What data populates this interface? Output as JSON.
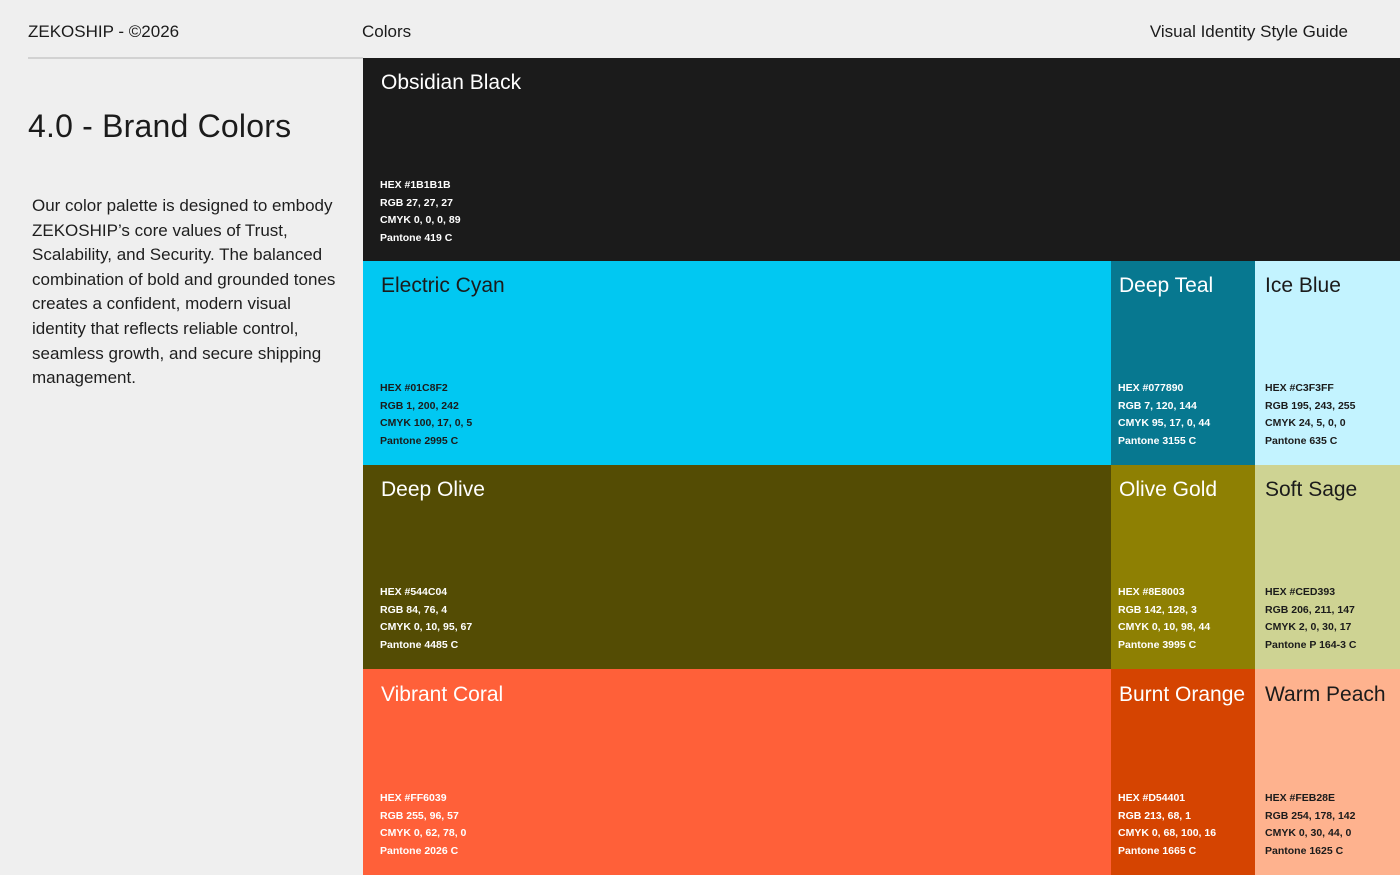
{
  "header": {
    "brand": "ZEKOSHIP - ©2026",
    "section": "Colors",
    "guide": "Visual Identity Style Guide"
  },
  "title": "4.0 - Brand Colors",
  "intro": "Our color palette is designed to embody ZEKOSHIP’s core values of Trust, Scalability, and Security. The balanced combination of bold and grounded tones creates a confident, modern visual identity that reflects reliable control, seamless growth, and secure shipping management.",
  "colors": {
    "obsidian": {
      "name": "Obsidian Black",
      "bg": "#1B1B1B",
      "fg": "#FFFFFF",
      "hex": "HEX #1B1B1B",
      "rgb": "RGB 27, 27, 27",
      "cmyk": "CMYK 0, 0, 0, 89",
      "pantone": "Pantone 419 C"
    },
    "cyan": {
      "name": "Electric Cyan",
      "bg": "#01C8F2",
      "fg": "#1B1B1B",
      "hex": "HEX #01C8F2",
      "rgb": "RGB 1, 200, 242",
      "cmyk": "CMYK 100, 17, 0, 5",
      "pantone": "Pantone 2995 C"
    },
    "teal": {
      "name": "Deep Teal",
      "bg": "#077890",
      "fg": "#FFFFFF",
      "hex": "HEX #077890",
      "rgb": "RGB 7, 120, 144",
      "cmyk": "CMYK 95, 17, 0, 44",
      "pantone": "Pantone 3155 C"
    },
    "ice": {
      "name": "Ice Blue",
      "bg": "#C3F3FF",
      "fg": "#1B1B1B",
      "hex": "HEX #C3F3FF",
      "rgb": "RGB 195, 243, 255",
      "cmyk": "CMYK 24, 5, 0, 0",
      "pantone": "Pantone 635 C"
    },
    "olive": {
      "name": "Deep Olive",
      "bg": "#544C04",
      "fg": "#FFFFFF",
      "hex": "HEX #544C04",
      "rgb": "RGB 84, 76, 4",
      "cmyk": "CMYK 0, 10, 95, 67",
      "pantone": "Pantone 4485 C"
    },
    "gold": {
      "name": "Olive Gold",
      "bg": "#8E8003",
      "fg": "#FFFFFF",
      "hex": "HEX #8E8003",
      "rgb": "RGB 142, 128, 3",
      "cmyk": "CMYK 0, 10, 98, 44",
      "pantone": "Pantone 3995 C"
    },
    "sage": {
      "name": "Soft Sage",
      "bg": "#CED393",
      "fg": "#1B1B1B",
      "hex": "HEX #CED393",
      "rgb": "RGB 206, 211, 147",
      "cmyk": "CMYK 2, 0, 30, 17",
      "pantone": "Pantone P 164-3 C"
    },
    "coral": {
      "name": "Vibrant Coral",
      "bg": "#FF6039",
      "fg": "#FFFFFF",
      "hex": "HEX #FF6039",
      "rgb": "RGB 255, 96, 57",
      "cmyk": "CMYK 0, 62, 78, 0",
      "pantone": "Pantone 2026 C"
    },
    "burnt": {
      "name": "Burnt Orange",
      "bg": "#D54401",
      "fg": "#FFFFFF",
      "hex": "HEX #D54401",
      "rgb": "RGB 213, 68, 1",
      "cmyk": "CMYK 0, 68, 100, 16",
      "pantone": "Pantone 1665 C"
    },
    "peach": {
      "name": "Warm Peach",
      "bg": "#FEB28E",
      "fg": "#1B1B1B",
      "hex": "HEX #FEB28E",
      "rgb": "RGB 254, 178, 142",
      "cmyk": "CMYK 0, 30, 44, 0",
      "pantone": "Pantone 1625 C"
    }
  }
}
